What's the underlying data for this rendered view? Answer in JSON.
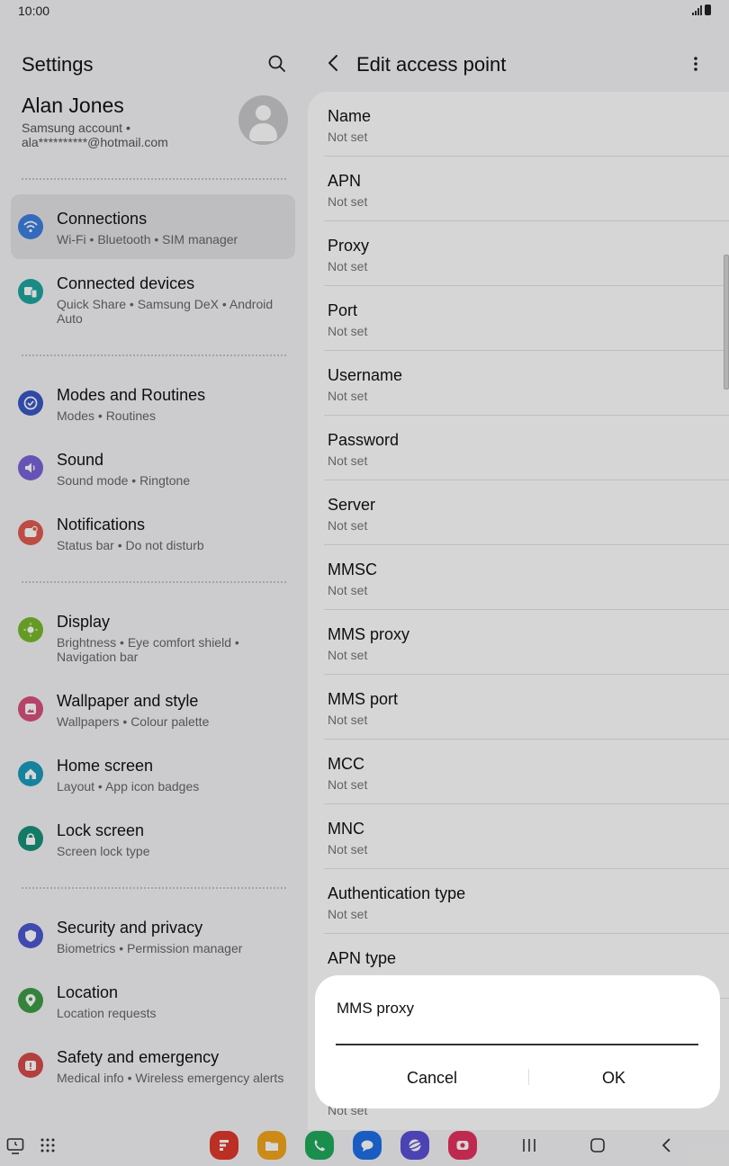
{
  "status_bar": {
    "time": "10:00"
  },
  "left_pane": {
    "title": "Settings",
    "account": {
      "name": "Alan Jones",
      "line1": "Samsung account  •",
      "line2": "ala**********@hotmail.com"
    },
    "items": [
      {
        "label": "Connections",
        "sub": "Wi-Fi  •  Bluetooth  •  SIM manager",
        "icon": "wifi-icon",
        "color": "#3d7fe0",
        "active": true
      },
      {
        "label": "Connected devices",
        "sub": "Quick Share  •  Samsung DeX  •  Android Auto",
        "icon": "connected-devices-icon",
        "color": "#1fa5a0"
      },
      {
        "label": "Modes and Routines",
        "sub": "Modes  •  Routines",
        "icon": "modes-check-icon",
        "color": "#3a57c7"
      },
      {
        "label": "Sound",
        "sub": "Sound mode  •  Ringtone",
        "icon": "speaker-icon",
        "color": "#7b63d8"
      },
      {
        "label": "Notifications",
        "sub": "Status bar  •  Do not disturb",
        "icon": "notification-icon",
        "color": "#e25c52"
      },
      {
        "label": "Display",
        "sub": "Brightness  •  Eye comfort shield  •  Navigation bar",
        "icon": "sun-icon",
        "color": "#79b92c"
      },
      {
        "label": "Wallpaper and style",
        "sub": "Wallpapers  •  Colour palette",
        "icon": "wallpaper-icon",
        "color": "#d8527c"
      },
      {
        "label": "Home screen",
        "sub": "Layout  •  App icon badges",
        "icon": "home-icon",
        "color": "#1a9bbd"
      },
      {
        "label": "Lock screen",
        "sub": "Screen lock type",
        "icon": "lock-icon",
        "color": "#17927a"
      },
      {
        "label": "Security and privacy",
        "sub": "Biometrics  •  Permission manager",
        "icon": "shield-icon",
        "color": "#4d57d0"
      },
      {
        "label": "Location",
        "sub": "Location requests",
        "icon": "location-pin-icon",
        "color": "#3e9c48"
      },
      {
        "label": "Safety and emergency",
        "sub": "Medical info  •  Wireless emergency alerts",
        "icon": "emergency-icon",
        "color": "#d64c4c"
      }
    ]
  },
  "right_pane": {
    "title": "Edit access point",
    "fields": [
      {
        "label": "Name",
        "value": "Not set"
      },
      {
        "label": "APN",
        "value": "Not set"
      },
      {
        "label": "Proxy",
        "value": "Not set"
      },
      {
        "label": "Port",
        "value": "Not set"
      },
      {
        "label": "Username",
        "value": "Not set"
      },
      {
        "label": "Password",
        "value": "Not set"
      },
      {
        "label": "Server",
        "value": "Not set"
      },
      {
        "label": "MMSC",
        "value": "Not set"
      },
      {
        "label": "MMS proxy",
        "value": "Not set"
      },
      {
        "label": "MMS port",
        "value": "Not set"
      },
      {
        "label": "MCC",
        "value": "Not set"
      },
      {
        "label": "MNC",
        "value": "Not set"
      },
      {
        "label": "Authentication type",
        "value": "Not set"
      },
      {
        "label": "APN type",
        "value": ""
      }
    ],
    "obscured_value": "Not set"
  },
  "dialog": {
    "title": "MMS proxy",
    "input_value": "",
    "cancel": "Cancel",
    "ok": "OK"
  },
  "navbar": {
    "apps": [
      {
        "name": "flipboard-app-icon",
        "color": "#e0382b"
      },
      {
        "name": "my-files-app-icon",
        "color": "#f3a51c"
      },
      {
        "name": "phone-app-icon",
        "color": "#1faa5c"
      },
      {
        "name": "messages-app-icon",
        "color": "#1f6fe8"
      },
      {
        "name": "internet-app-icon",
        "color": "#5a4fd6"
      },
      {
        "name": "camera-app-icon",
        "color": "#e4325f"
      }
    ]
  }
}
